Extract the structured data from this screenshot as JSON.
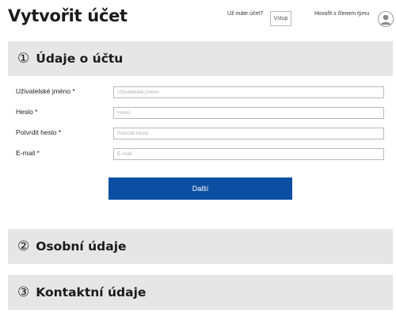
{
  "header": {
    "title": "Vytvořit účet",
    "login_prompt": "Už máte účet?",
    "login_button": "Vstup",
    "team_chat": "Hovořit s členem týmu",
    "avatar_icon": "user-avatar-icon"
  },
  "sections": [
    {
      "number": "①",
      "title": "Údaje o účtu"
    },
    {
      "number": "②",
      "title": "Osobní údaje"
    },
    {
      "number": "③",
      "title": "Kontaktní údaje"
    }
  ],
  "form": {
    "username": {
      "label": "Uživatelské jméno *",
      "placeholder": "Uživatelské jméno",
      "value": ""
    },
    "password": {
      "label": "Heslo *",
      "placeholder": "Heslo",
      "value": ""
    },
    "confirm_password": {
      "label": "Potvrdit heslo *",
      "placeholder": "Potvrdit heslo",
      "value": ""
    },
    "email": {
      "label": "E-mail *",
      "placeholder": "E-mail",
      "value": ""
    },
    "next_button": "Další"
  },
  "colors": {
    "primary_button": "#0b4ea2",
    "section_bar": "#e6e6e6",
    "input_border": "#b9b9b9"
  }
}
